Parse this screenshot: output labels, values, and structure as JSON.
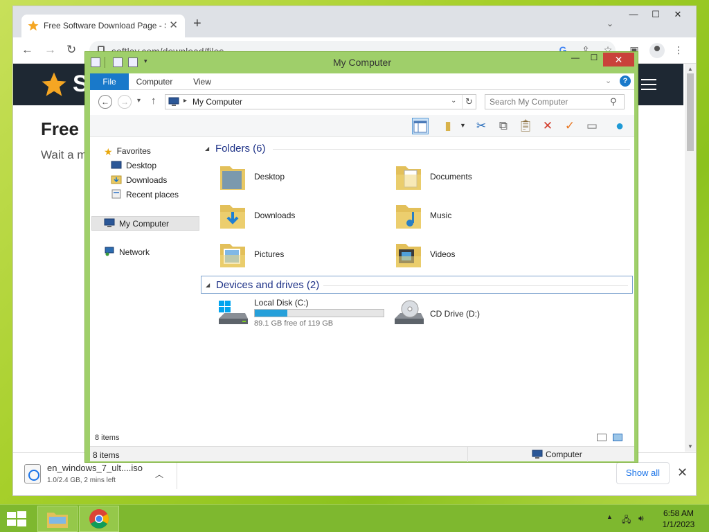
{
  "browser": {
    "tab_title": "Free Software Download Page - S",
    "tab_close": "✕",
    "new_tab": "+",
    "url": "softlay.com/download/files",
    "window_controls": {
      "minimize": "—",
      "maximize": "☐",
      "close": "✕"
    }
  },
  "site": {
    "logo_letter": "S",
    "heading": "Free S",
    "subtext": "Wait a m"
  },
  "download_bar": {
    "filename": "en_windows_7_ult....iso",
    "status": "1.0/2.4 GB, 2 mins left",
    "show_all": "Show all",
    "close": "✕"
  },
  "explorer": {
    "title": "My Computer",
    "ribbon_tabs": [
      "File",
      "Computer",
      "View"
    ],
    "address": "My Computer",
    "search_placeholder": "Search My Computer",
    "nav": {
      "favorites": "Favorites",
      "desktop": "Desktop",
      "downloads": "Downloads",
      "recent": "Recent places",
      "computer": "My Computer",
      "network": "Network"
    },
    "folders_header": "Folders (6)",
    "folders": [
      "Desktop",
      "Documents",
      "Downloads",
      "Music",
      "Pictures",
      "Videos"
    ],
    "devices_header": "Devices and drives (2)",
    "drives": {
      "c_name": "Local Disk (C:)",
      "c_free": "89.1 GB free of 119 GB",
      "c_used_fraction": 0.25,
      "d_name": "CD Drive (D:)"
    },
    "content_count": "8 items",
    "status_count": "8 items",
    "status_zone": "Computer"
  },
  "taskbar": {
    "time": "6:58 AM",
    "date": "1/1/2023"
  }
}
